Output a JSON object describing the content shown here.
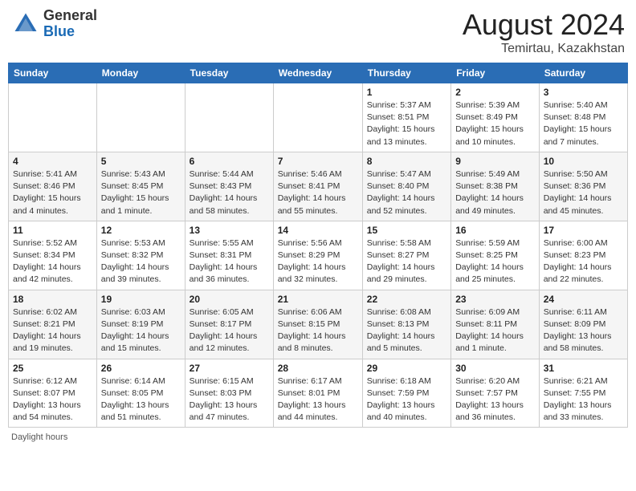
{
  "header": {
    "logo_general": "General",
    "logo_blue": "Blue",
    "month_title": "August 2024",
    "location": "Temirtau, Kazakhstan"
  },
  "days_of_week": [
    "Sunday",
    "Monday",
    "Tuesday",
    "Wednesday",
    "Thursday",
    "Friday",
    "Saturday"
  ],
  "footer": {
    "daylight_hours": "Daylight hours"
  },
  "weeks": [
    {
      "days": [
        {
          "num": "",
          "info": ""
        },
        {
          "num": "",
          "info": ""
        },
        {
          "num": "",
          "info": ""
        },
        {
          "num": "",
          "info": ""
        },
        {
          "num": "1",
          "info": "Sunrise: 5:37 AM\nSunset: 8:51 PM\nDaylight: 15 hours\nand 13 minutes."
        },
        {
          "num": "2",
          "info": "Sunrise: 5:39 AM\nSunset: 8:49 PM\nDaylight: 15 hours\nand 10 minutes."
        },
        {
          "num": "3",
          "info": "Sunrise: 5:40 AM\nSunset: 8:48 PM\nDaylight: 15 hours\nand 7 minutes."
        }
      ]
    },
    {
      "days": [
        {
          "num": "4",
          "info": "Sunrise: 5:41 AM\nSunset: 8:46 PM\nDaylight: 15 hours\nand 4 minutes."
        },
        {
          "num": "5",
          "info": "Sunrise: 5:43 AM\nSunset: 8:45 PM\nDaylight: 15 hours\nand 1 minute."
        },
        {
          "num": "6",
          "info": "Sunrise: 5:44 AM\nSunset: 8:43 PM\nDaylight: 14 hours\nand 58 minutes."
        },
        {
          "num": "7",
          "info": "Sunrise: 5:46 AM\nSunset: 8:41 PM\nDaylight: 14 hours\nand 55 minutes."
        },
        {
          "num": "8",
          "info": "Sunrise: 5:47 AM\nSunset: 8:40 PM\nDaylight: 14 hours\nand 52 minutes."
        },
        {
          "num": "9",
          "info": "Sunrise: 5:49 AM\nSunset: 8:38 PM\nDaylight: 14 hours\nand 49 minutes."
        },
        {
          "num": "10",
          "info": "Sunrise: 5:50 AM\nSunset: 8:36 PM\nDaylight: 14 hours\nand 45 minutes."
        }
      ]
    },
    {
      "days": [
        {
          "num": "11",
          "info": "Sunrise: 5:52 AM\nSunset: 8:34 PM\nDaylight: 14 hours\nand 42 minutes."
        },
        {
          "num": "12",
          "info": "Sunrise: 5:53 AM\nSunset: 8:32 PM\nDaylight: 14 hours\nand 39 minutes."
        },
        {
          "num": "13",
          "info": "Sunrise: 5:55 AM\nSunset: 8:31 PM\nDaylight: 14 hours\nand 36 minutes."
        },
        {
          "num": "14",
          "info": "Sunrise: 5:56 AM\nSunset: 8:29 PM\nDaylight: 14 hours\nand 32 minutes."
        },
        {
          "num": "15",
          "info": "Sunrise: 5:58 AM\nSunset: 8:27 PM\nDaylight: 14 hours\nand 29 minutes."
        },
        {
          "num": "16",
          "info": "Sunrise: 5:59 AM\nSunset: 8:25 PM\nDaylight: 14 hours\nand 25 minutes."
        },
        {
          "num": "17",
          "info": "Sunrise: 6:00 AM\nSunset: 8:23 PM\nDaylight: 14 hours\nand 22 minutes."
        }
      ]
    },
    {
      "days": [
        {
          "num": "18",
          "info": "Sunrise: 6:02 AM\nSunset: 8:21 PM\nDaylight: 14 hours\nand 19 minutes."
        },
        {
          "num": "19",
          "info": "Sunrise: 6:03 AM\nSunset: 8:19 PM\nDaylight: 14 hours\nand 15 minutes."
        },
        {
          "num": "20",
          "info": "Sunrise: 6:05 AM\nSunset: 8:17 PM\nDaylight: 14 hours\nand 12 minutes."
        },
        {
          "num": "21",
          "info": "Sunrise: 6:06 AM\nSunset: 8:15 PM\nDaylight: 14 hours\nand 8 minutes."
        },
        {
          "num": "22",
          "info": "Sunrise: 6:08 AM\nSunset: 8:13 PM\nDaylight: 14 hours\nand 5 minutes."
        },
        {
          "num": "23",
          "info": "Sunrise: 6:09 AM\nSunset: 8:11 PM\nDaylight: 14 hours\nand 1 minute."
        },
        {
          "num": "24",
          "info": "Sunrise: 6:11 AM\nSunset: 8:09 PM\nDaylight: 13 hours\nand 58 minutes."
        }
      ]
    },
    {
      "days": [
        {
          "num": "25",
          "info": "Sunrise: 6:12 AM\nSunset: 8:07 PM\nDaylight: 13 hours\nand 54 minutes."
        },
        {
          "num": "26",
          "info": "Sunrise: 6:14 AM\nSunset: 8:05 PM\nDaylight: 13 hours\nand 51 minutes."
        },
        {
          "num": "27",
          "info": "Sunrise: 6:15 AM\nSunset: 8:03 PM\nDaylight: 13 hours\nand 47 minutes."
        },
        {
          "num": "28",
          "info": "Sunrise: 6:17 AM\nSunset: 8:01 PM\nDaylight: 13 hours\nand 44 minutes."
        },
        {
          "num": "29",
          "info": "Sunrise: 6:18 AM\nSunset: 7:59 PM\nDaylight: 13 hours\nand 40 minutes."
        },
        {
          "num": "30",
          "info": "Sunrise: 6:20 AM\nSunset: 7:57 PM\nDaylight: 13 hours\nand 36 minutes."
        },
        {
          "num": "31",
          "info": "Sunrise: 6:21 AM\nSunset: 7:55 PM\nDaylight: 13 hours\nand 33 minutes."
        }
      ]
    }
  ]
}
